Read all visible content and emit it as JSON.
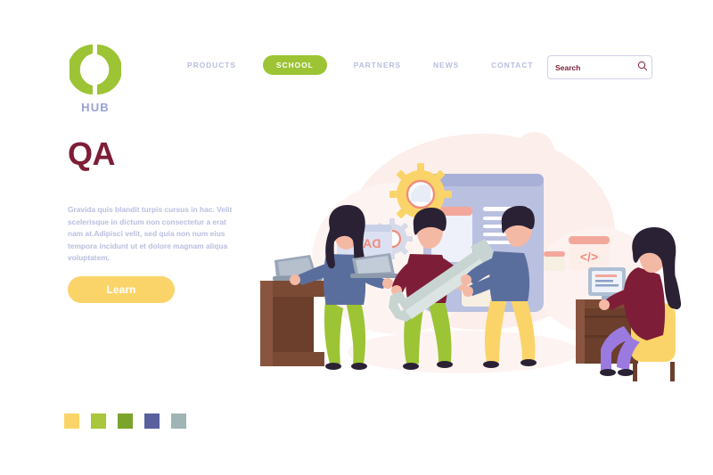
{
  "brand": {
    "logo_icon": "cd-circle-logo",
    "name": "HUB",
    "logo_color": "#9cc434",
    "name_color": "#9aa0d6"
  },
  "nav": {
    "items": [
      {
        "label": "PRODUCTS",
        "active": false
      },
      {
        "label": "SCHOOL",
        "active": true
      },
      {
        "label": "PARTNERS",
        "active": false
      },
      {
        "label": "NEWS",
        "active": false
      },
      {
        "label": "CONTACT",
        "active": false
      }
    ],
    "active_bg": "#9cc434",
    "inactive_color": "#b9bedf"
  },
  "search": {
    "placeholder": "Search",
    "value": "",
    "icon": "search-icon",
    "text_color": "#7e1d37",
    "border_color": "#cfd2ec"
  },
  "hero": {
    "title": "QA",
    "title_color": "#7e1d37",
    "body": "Gravida quis blandit turpis cursus in hac. Velit scelerisque in dictum non consectetur a erat nam at.Adipisci velit, sed quia non num eius tempora incidunt ut et dolore magnam aliqua voluptatem.",
    "body_color": "#b9bedf",
    "cta_label": "Learn",
    "cta_bg": "#fbd469",
    "cta_text_color": "#ffffff"
  },
  "swatches": [
    {
      "name": "swatch-yellow",
      "color": "#fbd469"
    },
    {
      "name": "swatch-yellow-green",
      "color": "#a9c63c"
    },
    {
      "name": "swatch-olive-green",
      "color": "#7aa42a"
    },
    {
      "name": "swatch-indigo",
      "color": "#5a5f9e"
    },
    {
      "name": "swatch-gray-teal",
      "color": "#9fb4b4"
    }
  ],
  "illustration": {
    "name": "qa-team-illustration",
    "card_data_label": "DATA",
    "card_code_label": "</>",
    "blob_color": "#fbeeeb",
    "board_color": "#b9c0e0",
    "gear_color": "#fbd469",
    "gear_ring_color": "#f08c7d",
    "wrench_color": "#c8d4d2",
    "desk_color": "#7b4a34",
    "chair_color": "#fbd469",
    "people": [
      {
        "name": "woman-at-standing-desk",
        "top": "#5a6e9e",
        "bottom": "#9cc434",
        "hair": "#2b2135"
      },
      {
        "name": "man-with-wrench",
        "top": "#7e1d37",
        "bottom": "#9cc434",
        "hair": "#2b2135"
      },
      {
        "name": "man-placing-card",
        "top": "#5a6e9e",
        "bottom": "#fbd469",
        "hair": "#2b2135"
      },
      {
        "name": "woman-seated-coding",
        "top": "#7e1d37",
        "bottom": "#9b7ae0",
        "hair": "#2b2135"
      }
    ]
  }
}
